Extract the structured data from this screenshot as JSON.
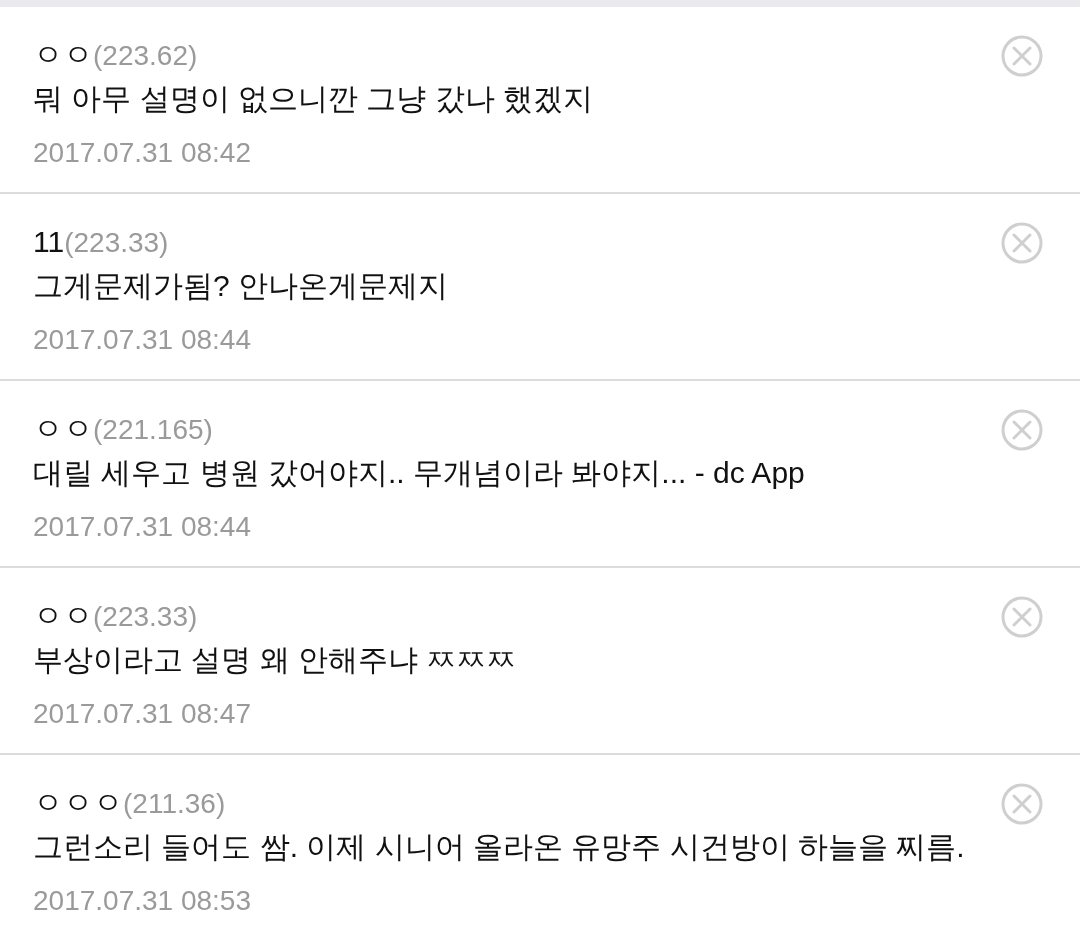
{
  "comments": [
    {
      "author": "ㅇㅇ",
      "ip": "(223.62)",
      "text": "뭐 아무 설명이 없으니깐 그냥 갔나 했겠지",
      "date": "2017.07.31 08:42"
    },
    {
      "author": "11",
      "ip": "(223.33)",
      "text": "그게문제가됨? 안나온게문제지",
      "date": "2017.07.31 08:44"
    },
    {
      "author": "ㅇㅇ",
      "ip": "(221.165)",
      "text": "대릴 세우고 병원 갔어야지.. 무개념이라 봐야지... - dc App",
      "date": "2017.07.31 08:44"
    },
    {
      "author": "ㅇㅇ",
      "ip": "(223.33)",
      "text": "부상이라고 설명 왜 안해주냐 ㅉㅉㅉ",
      "date": "2017.07.31 08:47"
    },
    {
      "author": "ㅇㅇㅇ",
      "ip": "(211.36)",
      "text": "그런소리 들어도 쌈. 이제 시니어 올라온 유망주 시건방이 하늘을 찌름.",
      "date": "2017.07.31 08:53"
    }
  ]
}
